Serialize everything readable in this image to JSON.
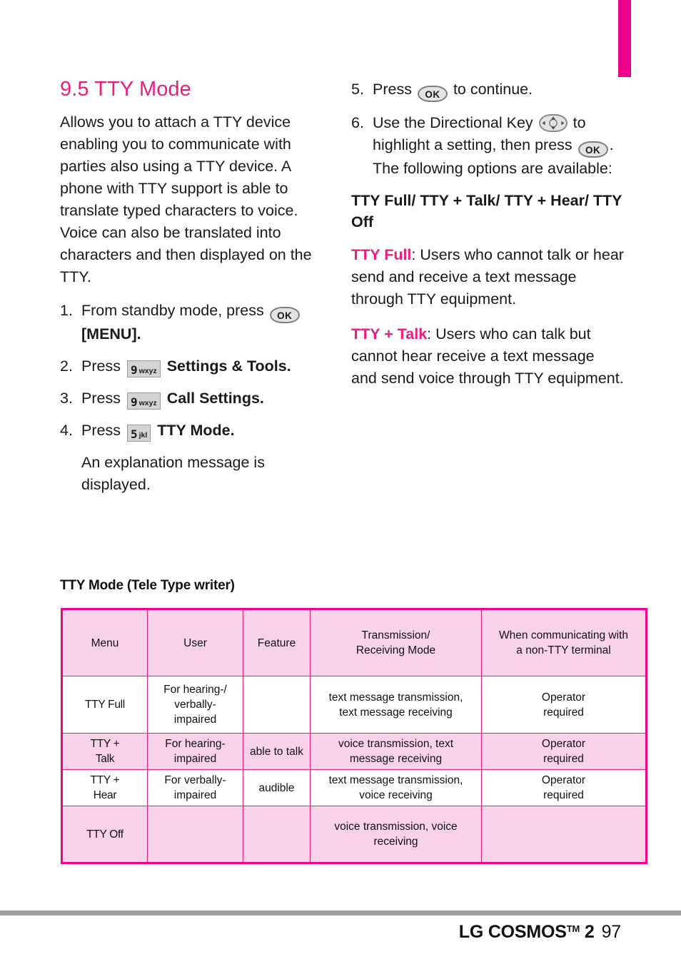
{
  "document": {
    "section_number": "9.5",
    "section_title": "9.5 TTY Mode",
    "accent_color": "#ec1c7d"
  },
  "left_column": {
    "intro": "Allows you to attach a TTY device enabling you to communicate with parties also using a TTY device. A phone with TTY support is able to translate typed characters to voice. Voice can also be translated into characters and then displayed on the TTY.",
    "steps": [
      {
        "num": "1.",
        "text_before": "From standby mode, press",
        "key": "OK",
        "text_after": "[MENU]."
      },
      {
        "num": "2.",
        "text_before": "Press",
        "key_digit": "9",
        "key_letters": "wxyz",
        "text_after": "Settings & Tools."
      },
      {
        "num": "3.",
        "text_before": "Press",
        "key_digit": "9",
        "key_letters": "wxyz",
        "text_after": "Call Settings."
      },
      {
        "num": "4.",
        "text_before": "Press",
        "key_digit": "5",
        "key_letters": "jkl",
        "text_after": "TTY Mode."
      }
    ],
    "note": "An explanation message is displayed."
  },
  "right_column": {
    "steps": [
      {
        "num": "5.",
        "text_before": "Press",
        "key": "OK",
        "text_after": "to continue."
      },
      {
        "num": "6.",
        "part1": "Use the Directional Key",
        "key_dir": "directional-key",
        "part2": "to highlight a setting, then press",
        "key_ok": "OK",
        "part3": ". The following options are available:"
      }
    ],
    "options_heading": "TTY Full/ TTY + Talk/ TTY + Hear/ TTY Off",
    "definitions": [
      {
        "term": "TTY Full",
        "body": ": Users who cannot  talk or hear send and receive a text message through TTY equipment."
      },
      {
        "term": "TTY + Talk",
        "body": ": Users who can talk but cannot hear receive a text message and send voice through TTY equipment."
      }
    ]
  },
  "table": {
    "caption": "TTY Mode (Tele Type writer)",
    "headers": [
      "Menu",
      "User",
      "Feature",
      "Transmission/\nReceiving Mode",
      "When communicating with\na non-TTY terminal"
    ],
    "header_lines": {
      "h0": "Menu",
      "h1": "User",
      "h2": "Feature",
      "h3a": "Transmission/",
      "h3b": "Receiving Mode",
      "h4a": "When communicating with",
      "h4b": "a non-TTY terminal"
    },
    "rows": [
      {
        "menu": "TTY Full",
        "user": "For hearing-/\nverbally-\nimpaired",
        "user_l1": "For hearing-/",
        "user_l2": "verbally-",
        "user_l3": "impaired",
        "feature": "",
        "mode_l1": "text message transmission,",
        "mode_l2": "text message receiving",
        "nontty_l1": "Operator",
        "nontty_l2": "required",
        "shade": "white"
      },
      {
        "menu": "TTY +\nTalk",
        "menu_l1": "TTY +",
        "menu_l2": "Talk",
        "user_l1": "For hearing-",
        "user_l2": "impaired",
        "user_l3": "",
        "feature": "able to talk",
        "mode_l1": "voice transmission, text",
        "mode_l2": "message receiving",
        "nontty_l1": "Operator",
        "nontty_l2": "required",
        "shade": "pink"
      },
      {
        "menu": "TTY +\nHear",
        "menu_l1": "TTY +",
        "menu_l2": "Hear",
        "user_l1": "For verbally-",
        "user_l2": "impaired",
        "user_l3": "",
        "feature": "audible",
        "mode_l1": "text message transmission,",
        "mode_l2": "voice receiving",
        "nontty_l1": "Operator",
        "nontty_l2": "required",
        "shade": "white"
      },
      {
        "menu": "TTY Off",
        "menu_l1": "TTY Off",
        "menu_l2": "",
        "user_l1": "",
        "user_l2": "",
        "user_l3": "",
        "feature": "",
        "mode_l1": "voice transmission, voice",
        "mode_l2": "receiving",
        "nontty_l1": "",
        "nontty_l2": "",
        "shade": "pink"
      }
    ]
  },
  "footer": {
    "brand": "LG COSMOS",
    "tm": "TM",
    "model": "2",
    "page_number": "97"
  }
}
